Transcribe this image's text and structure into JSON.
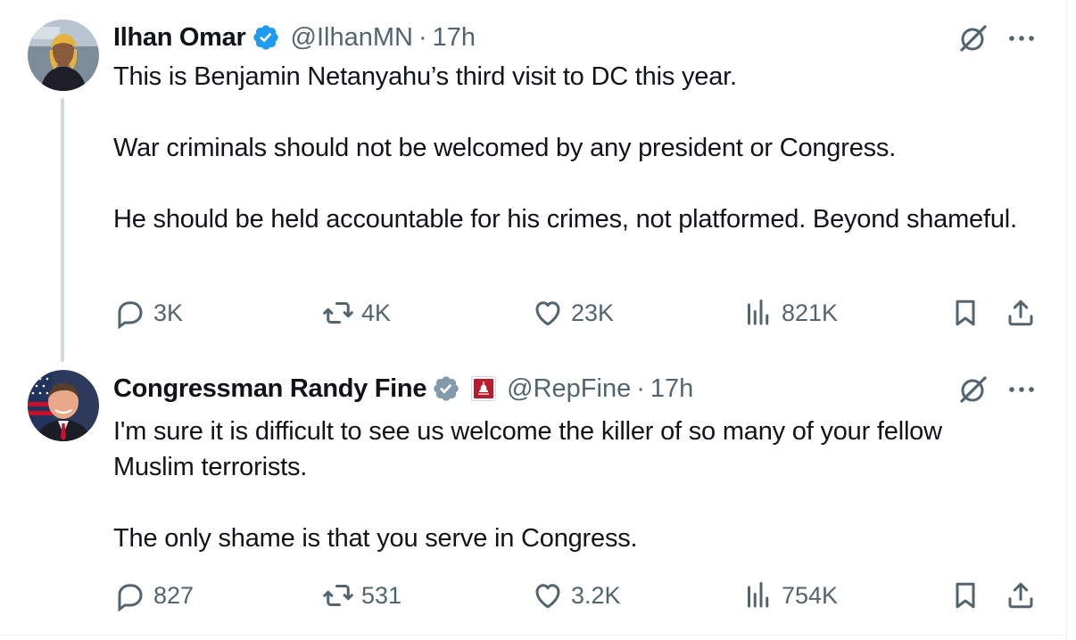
{
  "tweets": [
    {
      "author": "Ilhan Omar",
      "handle": "@IlhanMN",
      "separator": "·",
      "time": "17h",
      "verified_color": "#1d9bf0",
      "paragraphs": [
        "This is Benjamin Netanyahu’s third visit to DC this year.",
        "War criminals should not be welcomed by any president or Congress.",
        "He should be held accountable for his crimes, not platformed. Beyond shameful."
      ],
      "metrics": {
        "replies": "3K",
        "reposts": "4K",
        "likes": "23K",
        "views": "821K"
      }
    },
    {
      "author": "Congressman Randy Fine",
      "handle": "@RepFine",
      "separator": "·",
      "time": "17h",
      "verified_color": "#829aab",
      "affiliation_icon": "congress-seal-icon",
      "paragraphs": [
        "I'm sure it is difficult to see us welcome the killer of so many of your fellow Muslim terrorists.",
        "The only shame is that you serve in Congress."
      ],
      "metrics": {
        "replies": "827",
        "reposts": "531",
        "likes": "3.2K",
        "views": "754K"
      }
    }
  ],
  "colors": {
    "text": "#0f1419",
    "secondary": "#536471",
    "thread_line": "#cfd9de"
  }
}
